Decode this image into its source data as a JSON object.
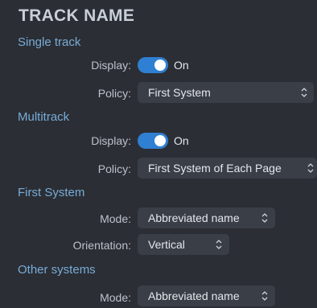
{
  "panel": {
    "title": "TRACK NAME"
  },
  "single_track": {
    "heading": "Single track",
    "display_label": "Display:",
    "display_value": "On",
    "policy_label": "Policy:",
    "policy_value": "First System"
  },
  "multitrack": {
    "heading": "Multitrack",
    "display_label": "Display:",
    "display_value": "On",
    "policy_label": "Policy:",
    "policy_value": "First System of Each Page"
  },
  "first_system": {
    "heading": "First System",
    "mode_label": "Mode:",
    "mode_value": "Abbreviated name",
    "orientation_label": "Orientation:",
    "orientation_value": "Vertical"
  },
  "other_systems": {
    "heading": "Other systems",
    "mode_label": "Mode:",
    "mode_value": "Abbreviated name"
  },
  "colors": {
    "background": "#2b2e34",
    "section_heading": "#78acd8",
    "toggle_on": "#2f7fd2",
    "dropdown_bg": "#3a3e46"
  },
  "icons": {
    "toggle_knob": "toggle-knob",
    "dropdown_chevron": "chevron-up-down-icon"
  }
}
